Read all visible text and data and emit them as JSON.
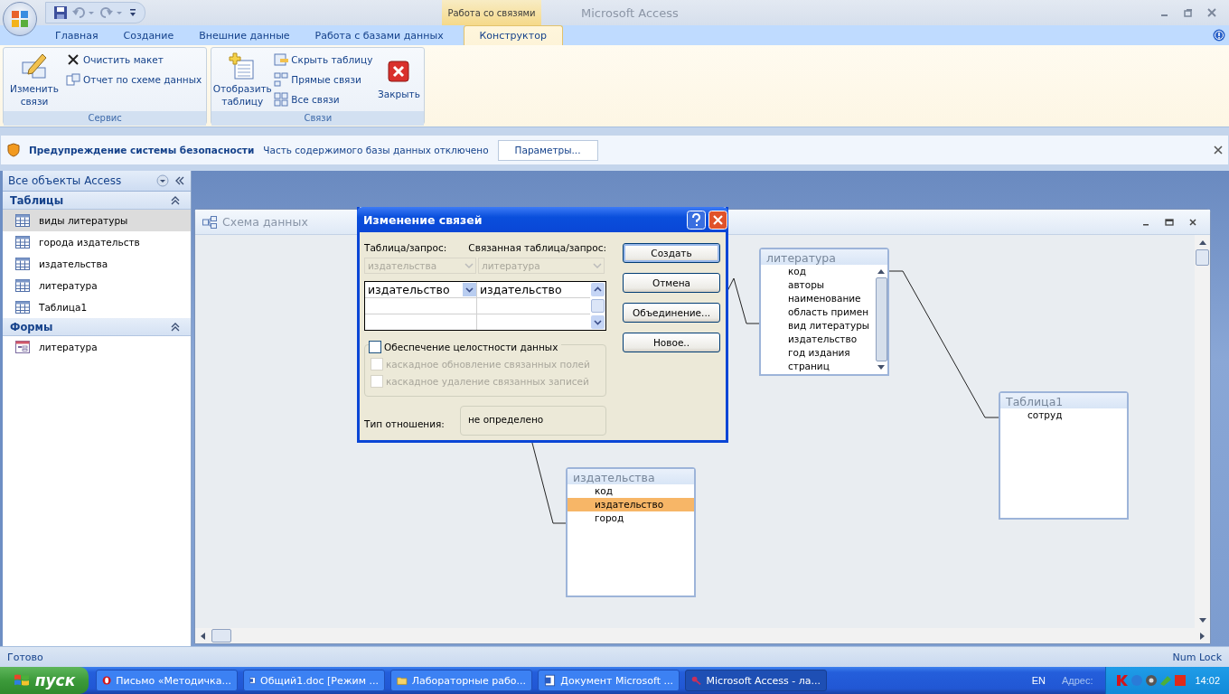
{
  "window": {
    "title": "Microsoft Access",
    "context_group": "Работа со связями"
  },
  "ribbon_tabs": [
    {
      "label": "Главная",
      "selected": false
    },
    {
      "label": "Создание",
      "selected": false
    },
    {
      "label": "Внешние данные",
      "selected": false
    },
    {
      "label": "Работа с базами данных",
      "selected": false
    },
    {
      "label": "Конструктор",
      "selected": true
    }
  ],
  "ribbon_groups": [
    {
      "title": "Сервис",
      "items": [
        {
          "kind": "large",
          "label": "Изменить связи"
        },
        {
          "kind": "small",
          "label": "Очистить макет"
        },
        {
          "kind": "small",
          "label": "Отчет по схеме данных"
        }
      ]
    },
    {
      "title": "Связи",
      "items": [
        {
          "kind": "large",
          "label": "Отобразить таблицу"
        },
        {
          "kind": "small",
          "label": "Скрыть таблицу"
        },
        {
          "kind": "small",
          "label": "Прямые связи"
        },
        {
          "kind": "small",
          "label": "Все связи"
        },
        {
          "kind": "large",
          "label": "Закрыть"
        }
      ]
    }
  ],
  "security_bar": {
    "title": "Предупреждение системы безопасности",
    "message": "Часть содержимого базы данных отключено",
    "button": "Параметры..."
  },
  "nav_pane": {
    "title": "Все объекты Access",
    "groups": [
      {
        "title": "Таблицы",
        "expanded": true,
        "items": [
          {
            "label": "виды литературы",
            "selected": true
          },
          {
            "label": "города издательств",
            "selected": false
          },
          {
            "label": "издательства",
            "selected": false
          },
          {
            "label": "литература",
            "selected": false
          },
          {
            "label": "Таблица1",
            "selected": false
          }
        ]
      },
      {
        "title": "Формы",
        "expanded": true,
        "items": [
          {
            "label": "литература",
            "selected": false
          }
        ]
      }
    ]
  },
  "diagram": {
    "title": "Схема данных",
    "tables": [
      {
        "title": "литература",
        "fields": [
          {
            "name": "код",
            "selected": false
          },
          {
            "name": "авторы",
            "selected": false
          },
          {
            "name": "наименование",
            "selected": false
          },
          {
            "name": "область примен",
            "selected": false
          },
          {
            "name": "вид литературы",
            "selected": false
          },
          {
            "name": "издательство",
            "selected": false
          },
          {
            "name": "год издания",
            "selected": false
          },
          {
            "name": "страниц",
            "selected": false
          }
        ]
      },
      {
        "title": "Таблица1",
        "fields": [
          {
            "name": "сотруд",
            "selected": false
          }
        ]
      },
      {
        "title": "издательства",
        "fields": [
          {
            "name": "код",
            "selected": false
          },
          {
            "name": "издательство",
            "selected": true
          },
          {
            "name": "город",
            "selected": false
          }
        ]
      }
    ]
  },
  "dialog": {
    "title": "Изменение связей",
    "table_label": "Таблица/запрос:",
    "related_label": "Связанная таблица/запрос:",
    "table_value": "издательства",
    "related_value": "литература",
    "grid_rows": [
      [
        "издательство",
        "издательство"
      ]
    ],
    "options": [
      {
        "label": "Обеспечение целостности данных",
        "checked": false,
        "disabled": false
      },
      {
        "label": "каскадное обновление связанных полей",
        "checked": false,
        "disabled": true
      },
      {
        "label": "каскадное удаление связанных записей",
        "checked": false,
        "disabled": true
      }
    ],
    "relation_type_label": "Тип отношения:",
    "relation_type": "не определено",
    "buttons": [
      "Создать",
      "Отмена",
      "Объединение...",
      "Новое.."
    ]
  },
  "status_bar": {
    "left": "Готово",
    "right": "Num Lock"
  },
  "taskbar": {
    "start": "пуск",
    "tasks": [
      {
        "label": "Письмо «Методичка...",
        "selected": false
      },
      {
        "label": "Общий1.doc [Режим ...",
        "selected": false
      },
      {
        "label": "Лабораторные рабо...",
        "selected": false
      },
      {
        "label": "Документ Microsoft ...",
        "selected": false
      },
      {
        "label": "Microsoft Access - ла...",
        "selected": true
      }
    ],
    "language": "EN",
    "address": "Адрес:",
    "time": "14:02"
  }
}
